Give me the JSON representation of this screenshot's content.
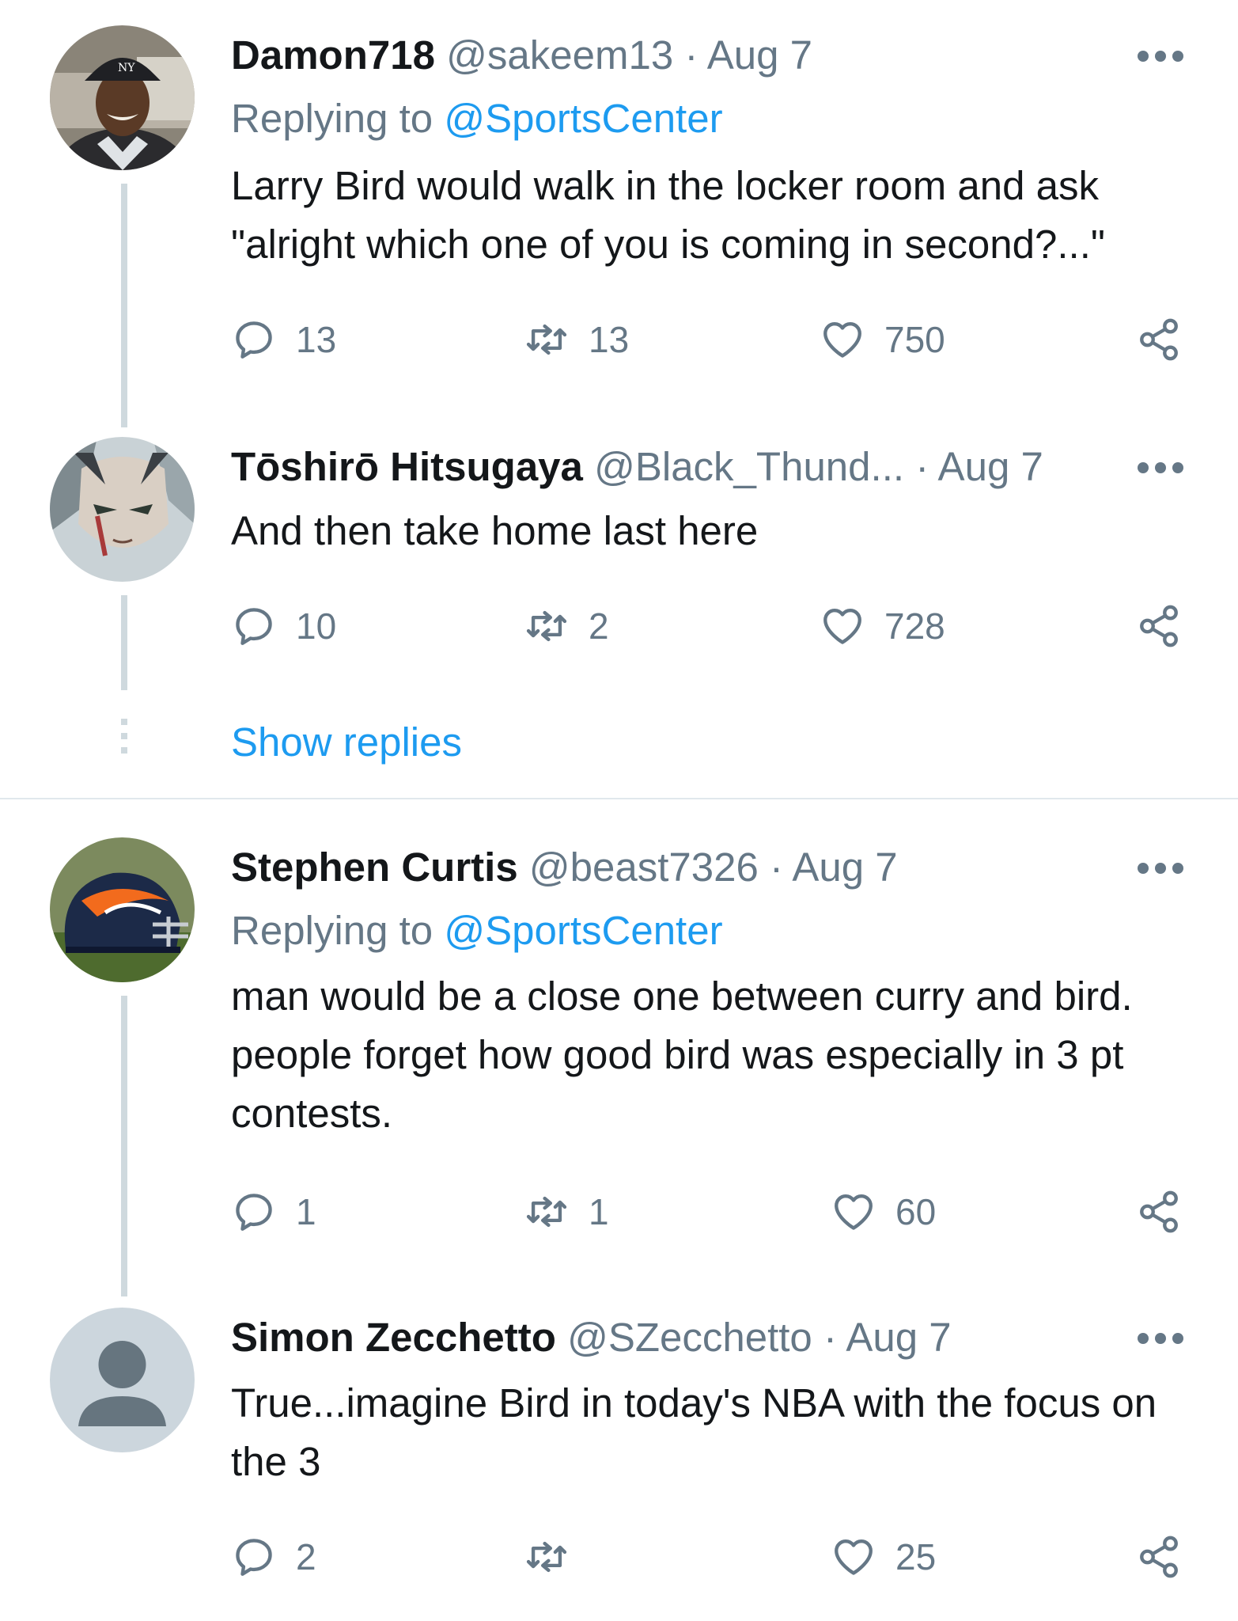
{
  "tweets": [
    {
      "name": "Damon718",
      "handle": "@sakeem13",
      "date": "· Aug 7",
      "replying_prefix": "Replying to ",
      "replying_to": "@SportsCenter",
      "text": "Larry Bird would walk in the locker room and ask \"alright which one of you is coming in second?...\"",
      "replies": "13",
      "retweets": "13",
      "likes": "750"
    },
    {
      "name": "Tōshirō Hitsugaya",
      "handle": "@Black_Thund...",
      "date": "· Aug 7",
      "text": "And then take home last here",
      "replies": "10",
      "retweets": "2",
      "likes": "728"
    },
    {
      "name": "Stephen Curtis",
      "handle": "@beast7326",
      "date": "· Aug 7",
      "replying_prefix": "Replying to ",
      "replying_to": "@SportsCenter",
      "text": "man would be a close one between curry and bird. people forget how good bird was especially in 3 pt contests.",
      "replies": "1",
      "retweets": "1",
      "likes": "60"
    },
    {
      "name": "Simon Zecchetto",
      "handle": "@SZecchetto",
      "date": "· Aug 7",
      "text": "True...imagine Bird in today's NBA with the focus on the 3",
      "replies": "2",
      "retweets": "",
      "likes": "25"
    }
  ],
  "show_replies_label": "Show replies",
  "colors": {
    "text": "#14171a",
    "secondary": "#657786",
    "link": "#1d9bf0",
    "thread_line": "#cfd9de",
    "separator": "#e1e8ed"
  },
  "icons": [
    "reply-icon",
    "retweet-icon",
    "like-icon",
    "share-icon",
    "more-icon",
    "default-avatar-icon"
  ]
}
